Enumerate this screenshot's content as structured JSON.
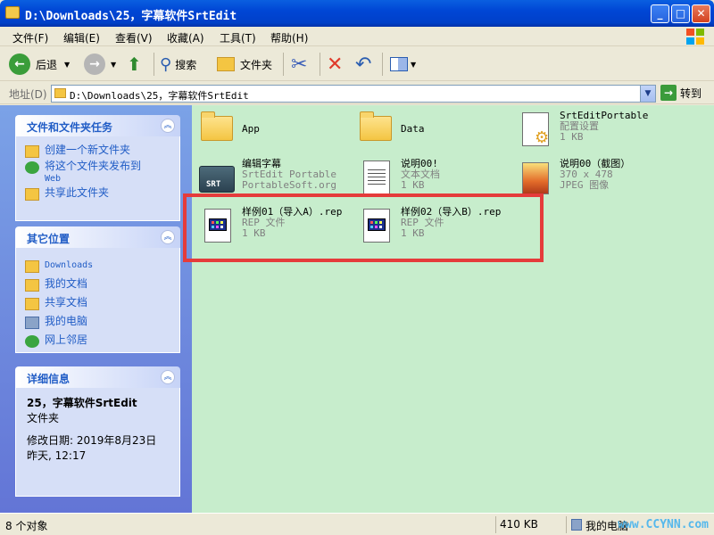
{
  "window": {
    "title": "D:\\Downloads\\25，字幕软件SrtEdit"
  },
  "menu": [
    "文件(F)",
    "编辑(E)",
    "查看(V)",
    "收藏(A)",
    "工具(T)",
    "帮助(H)"
  ],
  "toolbar": {
    "back": "后退",
    "search": "搜索",
    "folders": "文件夹"
  },
  "address": {
    "label": "地址(D)",
    "path": "D:\\Downloads\\25，字幕软件SrtEdit",
    "go": "转到"
  },
  "tasks": {
    "title": "文件和文件夹任务",
    "items": [
      "创建一个新文件夹",
      "将这个文件夹发布到",
      "Web",
      "共享此文件夹"
    ]
  },
  "places": {
    "title": "其它位置",
    "items": [
      "Downloads",
      "我的文档",
      "共享文档",
      "我的电脑",
      "网上邻居"
    ]
  },
  "details": {
    "title": "详细信息",
    "name": "25，字幕软件SrtEdit",
    "type": "文件夹",
    "modified_label": "修改日期: 2019年8月23日",
    "modified_time": "昨天, 12:17"
  },
  "files": [
    {
      "name": "App",
      "l2": "",
      "l3": ""
    },
    {
      "name": "Data",
      "l2": "",
      "l3": ""
    },
    {
      "name": "SrtEditPortable",
      "l2": "配置设置",
      "l3": "1 KB"
    },
    {
      "name": "编辑字幕",
      "l2": "SrtEdit Portable",
      "l3": "PortableSoft.org"
    },
    {
      "name": "说明00!",
      "l2": "文本文档",
      "l3": "1 KB"
    },
    {
      "name": "说明00（截图）",
      "l2": "370 x 478",
      "l3": "JPEG 图像"
    },
    {
      "name": "样例01（导入A）.rep",
      "l2": "REP 文件",
      "l3": "1 KB"
    },
    {
      "name": "样例02（导入B）.rep",
      "l2": "REP 文件",
      "l3": "1 KB"
    }
  ],
  "status": {
    "count": "8 个对象",
    "size": "410 KB",
    "location": "我的电脑",
    "watermark": "www.CCYNN.com"
  },
  "colors": {
    "highlight": "#e53b3b",
    "file_bg": "#c7edcc",
    "link": "#215dc6"
  }
}
